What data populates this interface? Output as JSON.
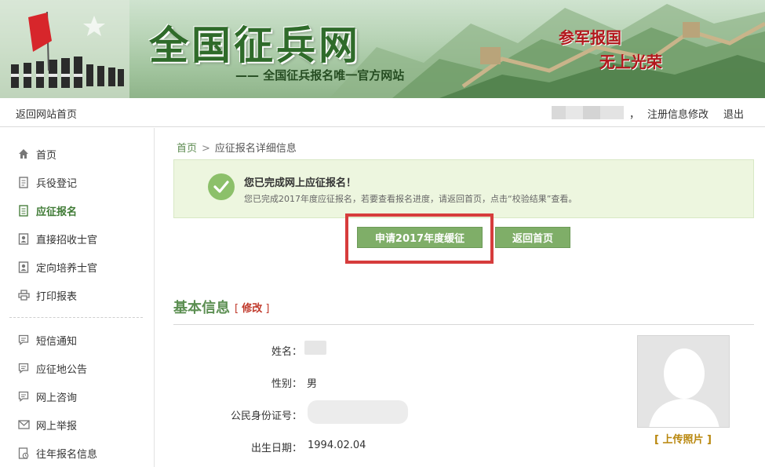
{
  "header": {
    "site_title": "全国征兵网",
    "site_subtitle": "—— 全国征兵报名唯一官方网站",
    "slogan_line1": "参军报国",
    "slogan_line2": "无上光荣"
  },
  "topbar": {
    "home_link": "返回网站首页",
    "comma": "，",
    "edit_registration": "注册信息修改",
    "logout": "退出"
  },
  "sidebar": {
    "items": [
      {
        "label": "首页",
        "icon": "home-icon"
      },
      {
        "label": "兵役登记",
        "icon": "document-icon"
      },
      {
        "label": "应征报名",
        "icon": "form-icon",
        "active": true
      },
      {
        "label": "直接招收士官",
        "icon": "id-card-icon"
      },
      {
        "label": "定向培养士官",
        "icon": "id-card-icon"
      },
      {
        "label": "打印报表",
        "icon": "printer-icon"
      },
      {
        "label": "短信通知",
        "icon": "message-icon"
      },
      {
        "label": "应征地公告",
        "icon": "message-icon"
      },
      {
        "label": "网上咨询",
        "icon": "message-icon"
      },
      {
        "label": "网上举报",
        "icon": "mail-icon"
      },
      {
        "label": "往年报名信息",
        "icon": "history-icon"
      }
    ]
  },
  "breadcrumb": {
    "home": "首页",
    "separator": ">",
    "current": "应征报名详细信息"
  },
  "notice": {
    "title": "您已完成网上应征报名！",
    "detail": "您已完成2017年度应征报名，若要查看报名进度，请返回首页，点击“校验结果”查看。"
  },
  "actions": {
    "defer_button": "申请2017年度缓征",
    "back_button": "返回首页"
  },
  "basic_info": {
    "section_title": "基本信息",
    "edit_open": "[",
    "edit_label": "修改",
    "edit_close": "]",
    "name_label": "姓名：",
    "gender_label": "性别：",
    "gender_value": "男",
    "id_label": "公民身份证号：",
    "birth_label": "出生日期：",
    "birth_value": "1994.02.04",
    "upload_open": "[",
    "upload_label": "上传照片",
    "upload_close": "]"
  },
  "colors": {
    "accent_green": "#7fae68",
    "title_green": "#5c8f52",
    "highlight_red": "#d63c3c",
    "notice_bg": "#edf6df"
  }
}
